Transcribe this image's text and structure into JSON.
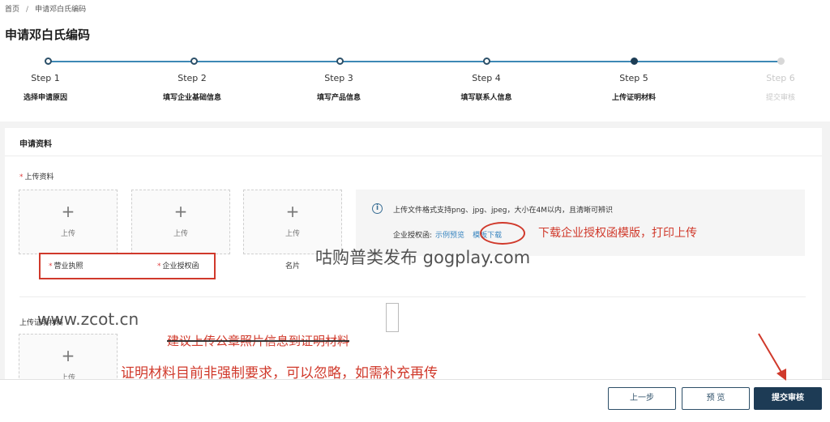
{
  "breadcrumb": {
    "home": "首页",
    "separator": "/",
    "current": "申请邓白氏编码"
  },
  "page_title": "申请邓白氏编码",
  "steps": [
    {
      "num": "Step 1",
      "name": "选择申请原因",
      "state": "done"
    },
    {
      "num": "Step 2",
      "name": "填写企业基础信息",
      "state": "done"
    },
    {
      "num": "Step 3",
      "name": "填写产品信息",
      "state": "done"
    },
    {
      "num": "Step 4",
      "name": "填写联系人信息",
      "state": "done"
    },
    {
      "num": "Step 5",
      "name": "上传证明材料",
      "state": "current"
    },
    {
      "num": "Step 6",
      "name": "提交审核",
      "state": "todo"
    }
  ],
  "card": {
    "title": "申请资料",
    "upload_section_label": "上传资料",
    "required_mark": "*",
    "upload_button_label": "上传",
    "docs": [
      "营业执照",
      "企业授权函",
      "名片"
    ],
    "info_text": "上传文件格式支持png、jpg、jpeg，大小在4M以内，且清晰可辨识",
    "auth_label": "企业授权函:",
    "sample_link": "示例预览",
    "template_link": "模板下载",
    "proof_section_label": "上传证明材料"
  },
  "annotations": {
    "template_hint": "下载企业授权函模版，打印上传",
    "struck_text": "建议上传公章照片信息到证明材料",
    "optional_note": "证明材料目前非强制要求，可以忽略，如需补充再传"
  },
  "watermarks": {
    "mark1": "咕购普类发布 gogplay.com",
    "mark2": "www.zcot.cn"
  },
  "footer": {
    "prev": "上一步",
    "preview": "预 览",
    "submit": "提交审核"
  },
  "colors": {
    "accent": "#1d3b55",
    "annotation": "#d0392b",
    "link": "#3a86c0"
  }
}
